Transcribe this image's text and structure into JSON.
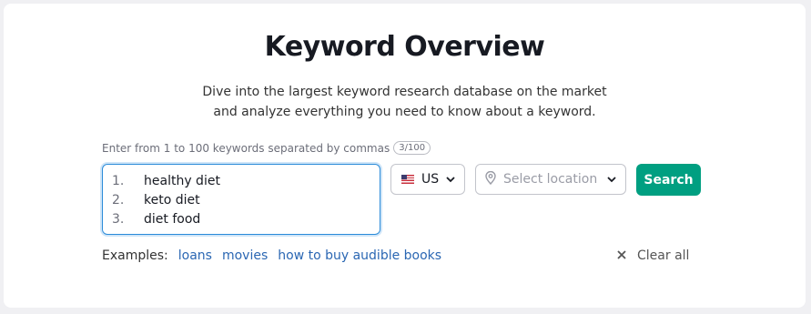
{
  "header": {
    "title": "Keyword Overview",
    "subtitle_line1": "Dive into the largest keyword research database on the market",
    "subtitle_line2": "and analyze everything you need to know about a keyword."
  },
  "input": {
    "hint": "Enter from 1 to 100 keywords separated by commas",
    "counter": "3/100",
    "keywords": [
      {
        "num": "1.",
        "text": "healthy diet"
      },
      {
        "num": "2.",
        "text": "keto diet"
      },
      {
        "num": "3.",
        "text": "diet food"
      }
    ]
  },
  "database": {
    "value": "US",
    "icon": "us-flag-icon"
  },
  "location": {
    "placeholder": "Select location",
    "icon": "location-pin-icon"
  },
  "search": {
    "label": "Search",
    "color": "#009f81"
  },
  "examples": {
    "label": "Examples:",
    "items": [
      "loans",
      "movies",
      "how to buy audible books"
    ]
  },
  "clear": {
    "label": "Clear all"
  }
}
